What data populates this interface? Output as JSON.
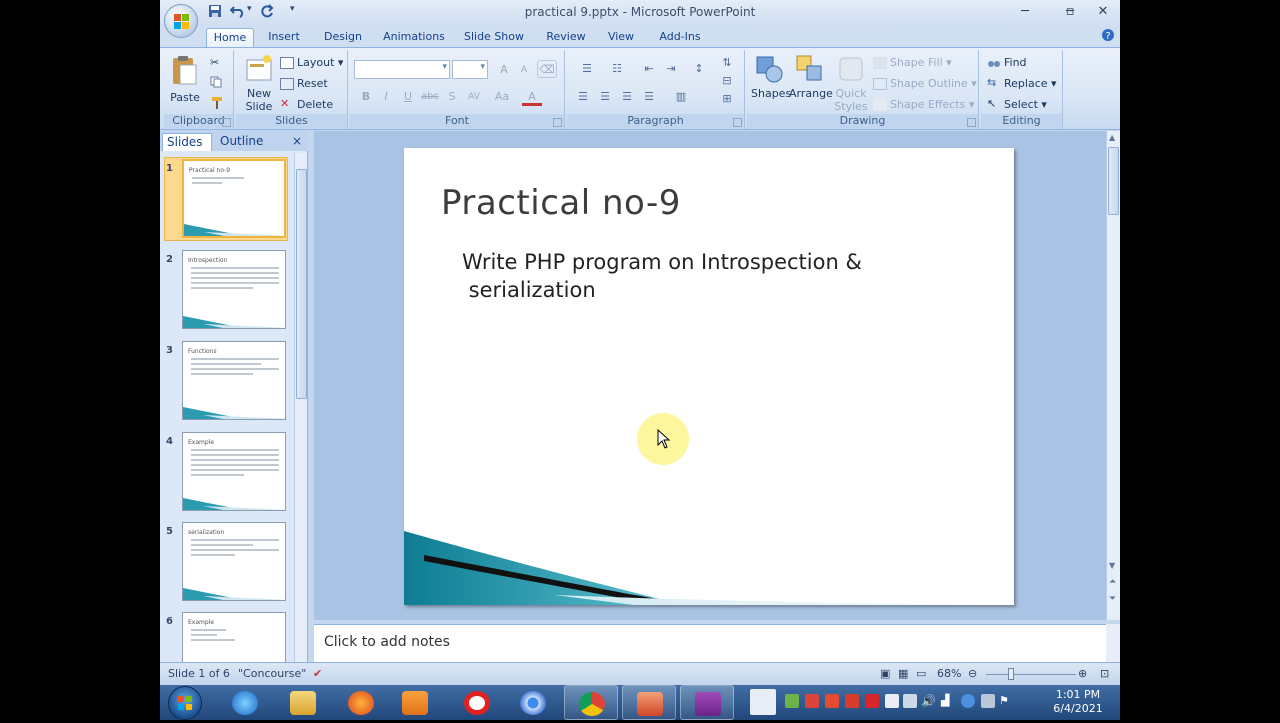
{
  "window": {
    "title": "practical 9.pptx - Microsoft PowerPoint",
    "minimize": "─",
    "maximize": "▫",
    "close": "✕"
  },
  "qat": {
    "save": "💾",
    "undo": "↶",
    "redo": "↻",
    "more": "▾"
  },
  "tabs": [
    "Home",
    "Insert",
    "Design",
    "Animations",
    "Slide Show",
    "Review",
    "View",
    "Add-Ins"
  ],
  "ribbon": {
    "clipboard": {
      "label": "Clipboard",
      "paste": "Paste"
    },
    "slides": {
      "label": "Slides",
      "new_slide": "New",
      "new_slide2": "Slide",
      "layout": "Layout",
      "reset": "Reset",
      "delete": "Delete"
    },
    "font": {
      "label": "Font",
      "bold": "B",
      "italic": "I",
      "underline": "U",
      "strike": "abc",
      "shadow": "S",
      "spacing": "AV",
      "case": "Aa",
      "color": "A",
      "grow": "A",
      "shrink": "A"
    },
    "paragraph": {
      "label": "Paragraph"
    },
    "drawing": {
      "label": "Drawing",
      "shapes": "Shapes",
      "arrange": "Arrange",
      "quick": "Quick",
      "styles": "Styles",
      "fill": "Shape Fill",
      "outline": "Shape Outline",
      "effects": "Shape Effects"
    },
    "editing": {
      "label": "Editing",
      "find": "Find",
      "replace": "Replace",
      "select": "Select"
    }
  },
  "leftpane": {
    "tab_slides": "Slides",
    "tab_outline": "Outline",
    "close": "×",
    "slides": [
      {
        "num": "1",
        "title": "Practical no-9"
      },
      {
        "num": "2",
        "title": "Introspection"
      },
      {
        "num": "3",
        "title": "Functions"
      },
      {
        "num": "4",
        "title": "Example"
      },
      {
        "num": "5",
        "title": "serialization"
      },
      {
        "num": "6",
        "title": "Example"
      }
    ]
  },
  "slide": {
    "title": "Practical no-9",
    "body_line1": "Write PHP program on Introspection &",
    "body_line2": " serialization"
  },
  "notes": {
    "placeholder": "Click to add notes"
  },
  "status": {
    "slide_info": "Slide 1 of 6",
    "theme": "\"Concourse\"",
    "zoom": "68%"
  },
  "taskbar": {
    "time": "1:01 PM",
    "date": "6/4/2021"
  }
}
